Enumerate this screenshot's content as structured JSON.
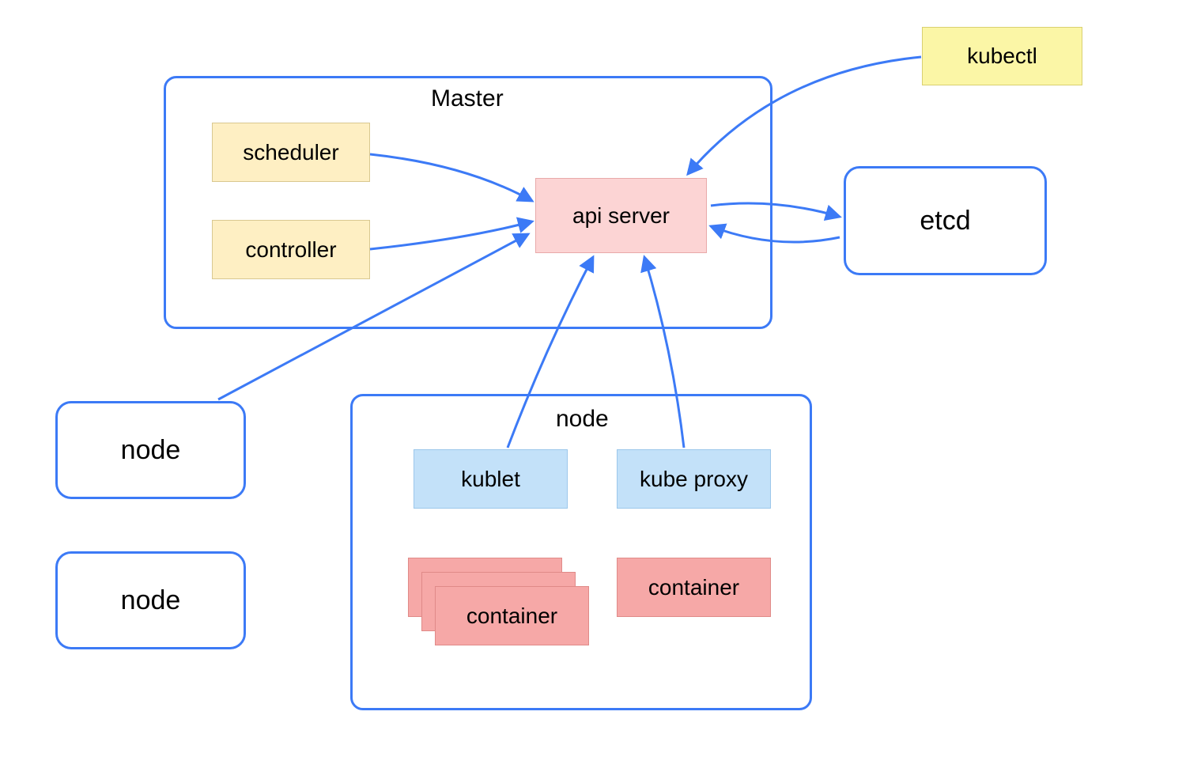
{
  "master": {
    "title": "Master",
    "scheduler": "scheduler",
    "controller": "controller",
    "apiserver": "api server"
  },
  "kubectl": "kubectl",
  "etcd": "etcd",
  "node_left_top": "node",
  "node_left_bottom": "node",
  "worker_node": {
    "title": "node",
    "kubelet": "kublet",
    "kubeproxy": "kube proxy",
    "container_stack": "container",
    "container_single": "container"
  },
  "arrows": [
    {
      "from": "scheduler",
      "to": "apiserver"
    },
    {
      "from": "controller",
      "to": "apiserver"
    },
    {
      "from": "kubectl",
      "to": "apiserver"
    },
    {
      "from": "node_left_top",
      "to": "apiserver"
    },
    {
      "from": "apiserver",
      "to_from": "etcd",
      "bidirectional": true
    },
    {
      "from": "kubelet",
      "to": "apiserver"
    },
    {
      "from": "kubeproxy",
      "to": "apiserver"
    }
  ],
  "colors": {
    "border_blue": "#3c7af6",
    "yellow_fill": "#feefc3",
    "yellow2_fill": "#fbf6a6",
    "pink_fill": "#fcd4d4",
    "red_fill": "#f6a8a7",
    "blue_fill": "#c3e1f9"
  }
}
